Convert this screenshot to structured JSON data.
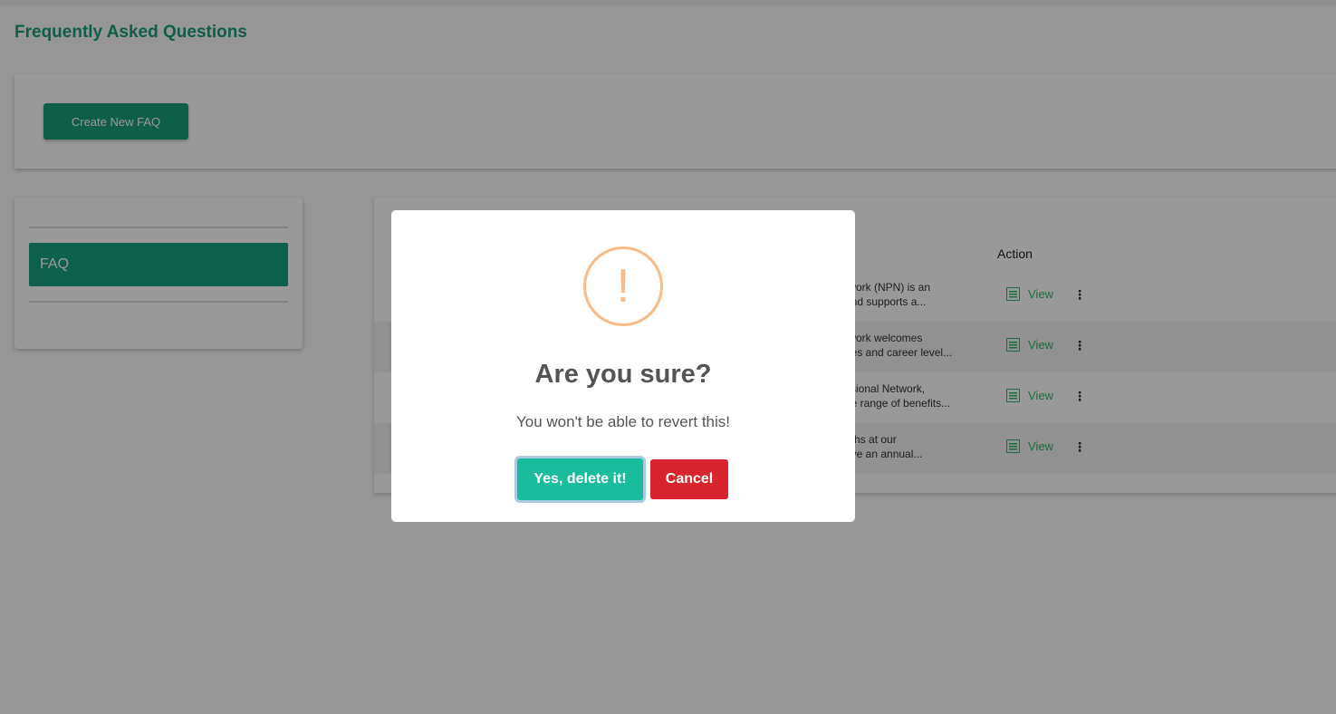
{
  "page": {
    "title": "Frequently Asked Questions"
  },
  "toolbar": {
    "create_label": "Create New FAQ"
  },
  "sidebar": {
    "items": [
      {
        "label": "FAQ"
      }
    ]
  },
  "table": {
    "action_header": "Action",
    "rows": [
      {
        "line1": "twork (NPN) is an",
        "line2": "and supports a...",
        "view_label": "View"
      },
      {
        "line1": "twork welcomes",
        "line2": "ries and career level...",
        "view_label": "View"
      },
      {
        "line1": "ssional Network,",
        "line2": "de range of benefits...",
        "view_label": "View"
      },
      {
        "line1": "nths at our",
        "line2": "ave an annual...",
        "view_label": "View"
      }
    ]
  },
  "modal": {
    "icon": "!",
    "title": "Are you sure?",
    "text": "You won't be able to revert this!",
    "confirm_label": "Yes, delete it!",
    "cancel_label": "Cancel"
  },
  "colors": {
    "brand": "#1a9e79",
    "warning": "#f8bb86",
    "confirm": "#1abc9c",
    "cancel": "#d9232d",
    "link": "#2fb468"
  }
}
